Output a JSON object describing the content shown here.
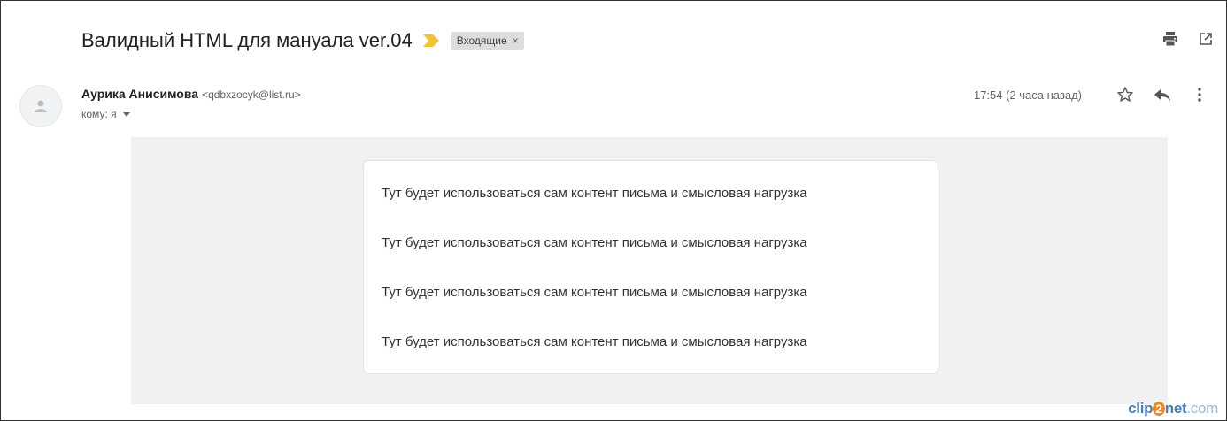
{
  "subject": {
    "title": "Валидный HTML для мануала ver.04",
    "label": "Входящие",
    "label_close": "×",
    "importance_color": "#f2c23a"
  },
  "top_actions": {
    "print_icon": "print-icon",
    "open_new_window_icon": "open-in-new-window-icon"
  },
  "sender": {
    "name": "Аурика Анисимова",
    "email": "<qdbxzocyk@list.ru>",
    "to_label": "кому: я"
  },
  "meta": {
    "timestamp": "17:54 (2 часа назад)",
    "star_icon": "star-icon",
    "reply_icon": "reply-icon",
    "more_icon": "more-vert-icon"
  },
  "message": {
    "lines": [
      "Тут будет использоваться сам контент письма и смысловая нагрузка",
      "Тут будет использоваться сам контент письма и смысловая нагрузка",
      "Тут будет использоваться сам контент письма и смысловая нагрузка",
      "Тут будет использоваться сам контент письма и смысловая нагрузка"
    ]
  },
  "watermark": {
    "part1": "clip",
    "part2": "2",
    "part3": "net",
    "part4": ".com"
  },
  "colors": {
    "body_background": "#f1f1f1",
    "card_background": "#ffffff",
    "text_primary": "#222222",
    "text_secondary": "#5f6368"
  }
}
